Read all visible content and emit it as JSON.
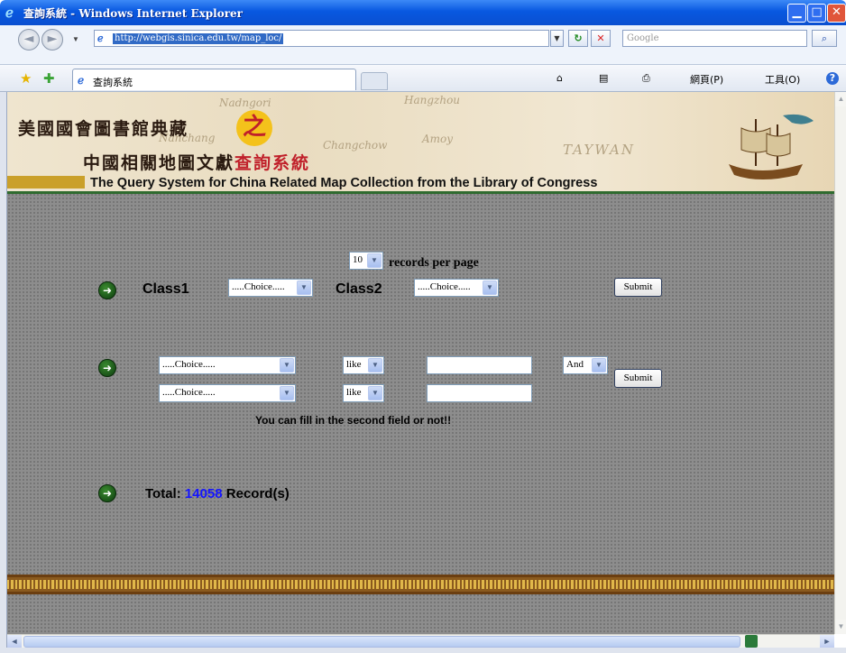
{
  "window": {
    "title": "查詢系統 - Windows Internet Explorer",
    "controls": {
      "minimize": "▁",
      "maximize": "□",
      "close": "✕"
    }
  },
  "nav": {
    "back": "◄",
    "forward": "►",
    "address_url": "http://webgis.sinica.edu.tw/map_loc/",
    "search_placeholder": "Google",
    "refresh_icon": "↻",
    "stop_icon": "✕",
    "go_icon": "⌕"
  },
  "favbar": {
    "tab_label": "查詢系統",
    "tools": {
      "home": "⌂",
      "feeds": "▤",
      "print": "⎙",
      "page_label": "網頁(P)",
      "tools_label": "工具(O)",
      "help": "?"
    }
  },
  "banner": {
    "line1": "美國國會圖書館典藏",
    "seal_char": "之",
    "line2_black": "中國相關地圖文獻",
    "line2_red": "查詢系統",
    "line3": "The Query System for China Related Map Collection from the Library of Congress",
    "map_words": [
      "Nadngori",
      "Hangzhou",
      "Amoy",
      "TAYWAN",
      "Nanchang",
      "Changchow"
    ]
  },
  "form1": {
    "records_per_page_value": "10",
    "records_per_page_label": "records per page",
    "class1_label": "Class1",
    "class1_value": ".....Choice.....",
    "class2_label": "Class2",
    "class2_value": ".....Choice.....",
    "submit_label": "Submit"
  },
  "form2": {
    "field1_value": ".....Choice.....",
    "op1_value": "like",
    "text1_value": "",
    "conj_value": "And",
    "field2_value": ".....Choice.....",
    "op2_value": "like",
    "text2_value": "",
    "submit_label": "Submit",
    "hint": "You can fill in the second field or not!!"
  },
  "total": {
    "label": "Total:",
    "count": "14058",
    "suffix": "Record(s)"
  },
  "colors": {
    "brand_red": "#c0202a",
    "count_blue": "#1414ff",
    "banner_green": "#2f6b2f"
  }
}
